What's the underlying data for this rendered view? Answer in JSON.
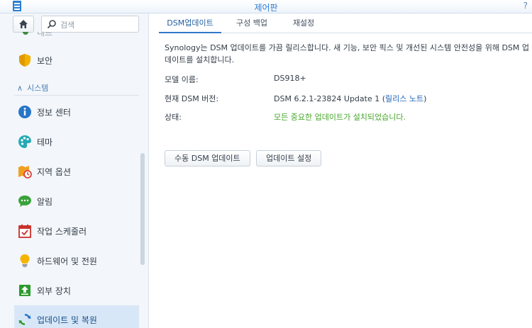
{
  "window": {
    "title": "제어판",
    "help_glyph": "?"
  },
  "search": {
    "placeholder": "검색"
  },
  "sidebar": {
    "partial_item_label": "네트",
    "security_label": "보안",
    "section_label": "시스템",
    "items": [
      {
        "label": "정보 센터",
        "icon": "info-icon"
      },
      {
        "label": "테마",
        "icon": "palette-icon"
      },
      {
        "label": "지역 옵션",
        "icon": "regional-options-icon"
      },
      {
        "label": "알림",
        "icon": "chat-bubble-icon"
      },
      {
        "label": "작업 스케줄러",
        "icon": "calendar-icon"
      },
      {
        "label": "하드웨어 및 전원",
        "icon": "lightbulb-icon"
      },
      {
        "label": "외부 장치",
        "icon": "external-device-icon"
      },
      {
        "label": "업데이트 및 복원",
        "icon": "update-restore-icon"
      }
    ]
  },
  "tabs": [
    {
      "label": "DSM업데이트",
      "active": true
    },
    {
      "label": "구성 백업",
      "active": false
    },
    {
      "label": "재설정",
      "active": false
    }
  ],
  "content": {
    "description": "Synology는 DSM 업데이트를 가끔 릴리스합니다. 새 기능, 보안 픽스 및 개선된 시스템 안전성을 위해 DSM 업데이트를 설치합니다.",
    "model_label": "모델 이름:",
    "model_value": "DS918+",
    "version_label": "현재 DSM 버전:",
    "version_value": "DSM 6.2.1-23824 Update 1 (",
    "release_notes_link": "릴리스 노트",
    "version_suffix": ")",
    "status_label": "상태:",
    "status_value": "모든 중요한 업데이트가 설치되었습니다."
  },
  "buttons": {
    "manual_update": "수동 DSM 업데이트",
    "update_settings": "업데이트 설정"
  },
  "colors": {
    "accent": "#2f78c8",
    "status_ok": "#47a72a",
    "link": "#1c64b8"
  }
}
